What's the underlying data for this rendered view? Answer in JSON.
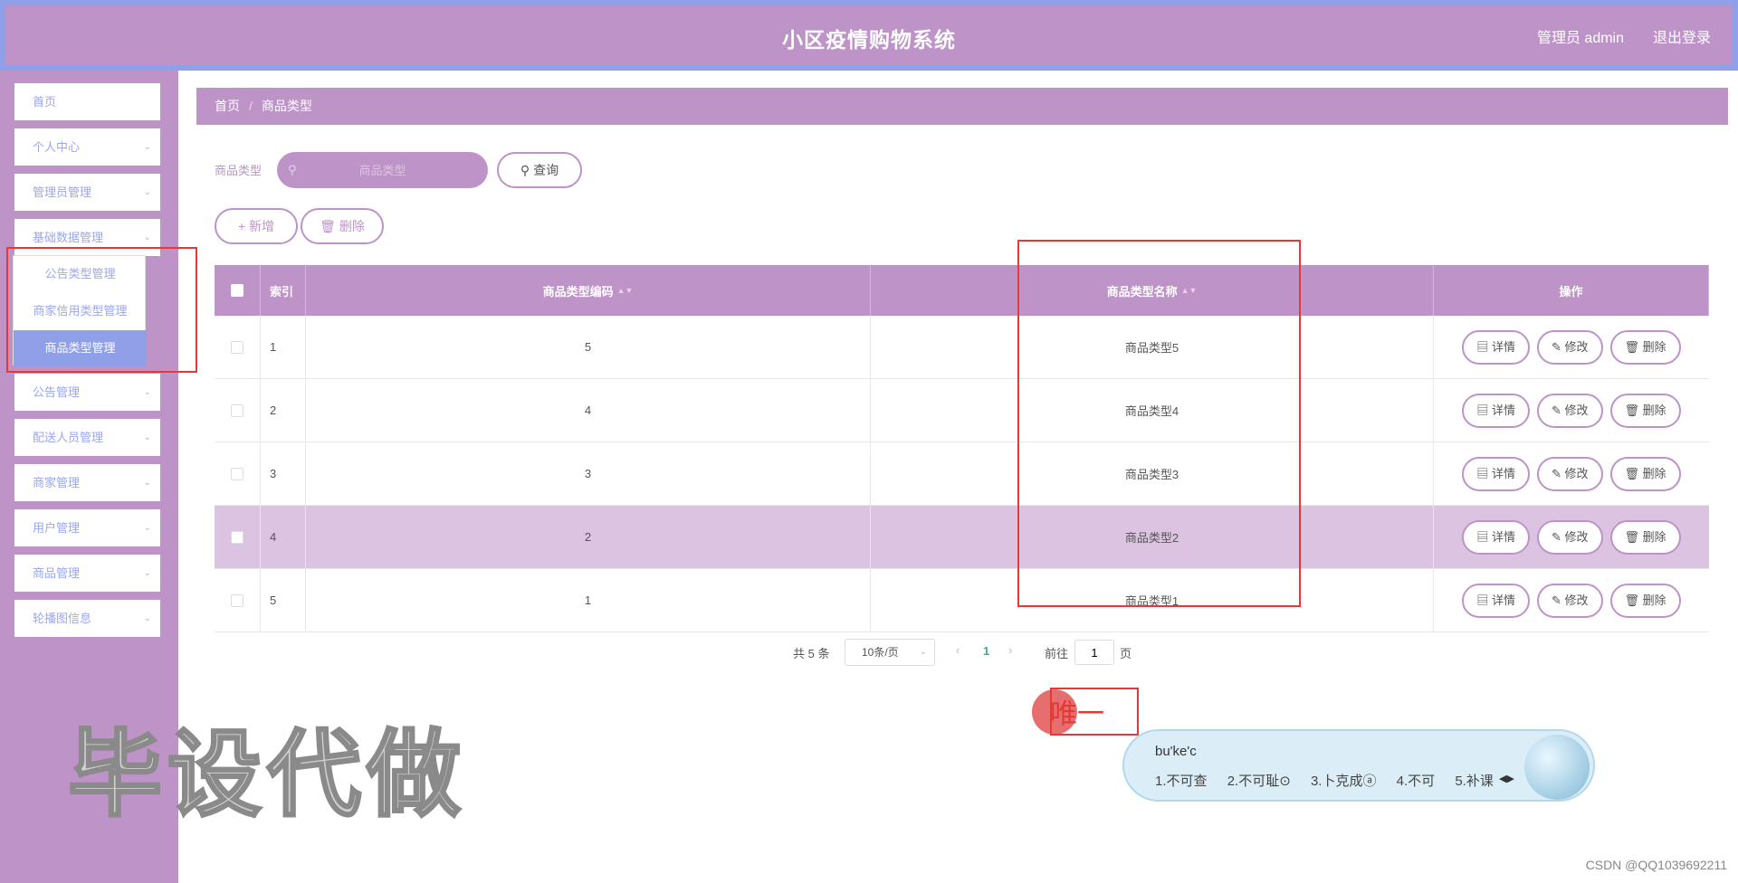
{
  "header": {
    "title": "小区疫情购物系统",
    "user": "管理员 admin",
    "logout": "退出登录"
  },
  "sidebar": {
    "items": [
      {
        "label": "首页",
        "has_children": false
      },
      {
        "label": "个人中心",
        "has_children": true
      },
      {
        "label": "管理员管理",
        "has_children": true
      },
      {
        "label": "基础数据管理",
        "has_children": true
      },
      {
        "label": "公告管理",
        "has_children": true
      },
      {
        "label": "配送人员管理",
        "has_children": true
      },
      {
        "label": "商家管理",
        "has_children": true
      },
      {
        "label": "用户管理",
        "has_children": true
      },
      {
        "label": "商品管理",
        "has_children": true
      },
      {
        "label": "轮播图信息",
        "has_children": true
      }
    ],
    "submenu": [
      "公告类型管理",
      "商家信用类型管理",
      "商品类型管理"
    ],
    "submenu_active": "商品类型管理"
  },
  "breadcrumb": {
    "home": "首页",
    "separator": "/",
    "current": "商品类型"
  },
  "search": {
    "label": "商品类型",
    "placeholder": "商品类型",
    "button": "查询"
  },
  "actions": {
    "add": "新增",
    "delete": "删除"
  },
  "table": {
    "headers": {
      "index": "索引",
      "code": "商品类型编码",
      "name": "商品类型名称",
      "ops": "操作"
    },
    "rows": [
      {
        "index": "1",
        "code": "5",
        "name": "商品类型5"
      },
      {
        "index": "2",
        "code": "4",
        "name": "商品类型4"
      },
      {
        "index": "3",
        "code": "3",
        "name": "商品类型3"
      },
      {
        "index": "4",
        "code": "2",
        "name": "商品类型2",
        "highlighted": true
      },
      {
        "index": "5",
        "code": "1",
        "name": "商品类型1"
      }
    ],
    "row_buttons": {
      "detail": "详情",
      "edit": "修改",
      "delete": "删除"
    }
  },
  "pagination": {
    "total": "共 5 条",
    "page_size": "10条/页",
    "current_page": "1",
    "goto_label": "前往",
    "goto_value": "1",
    "page_suffix": "页"
  },
  "overlay": {
    "ime_text": "唯一",
    "ime_composition": "bu'ke'c",
    "ime_candidates": [
      "1.不可查",
      "2.不可耻⊙",
      "3.卜克成ⓐ",
      "4.不可",
      "5.补课"
    ],
    "watermark": "毕设代做",
    "credit": "CSDN @QQ1039692211"
  },
  "colors": {
    "theme": "#bd93c8",
    "accent": "#8fa0e8",
    "annotation": "#e53935"
  }
}
